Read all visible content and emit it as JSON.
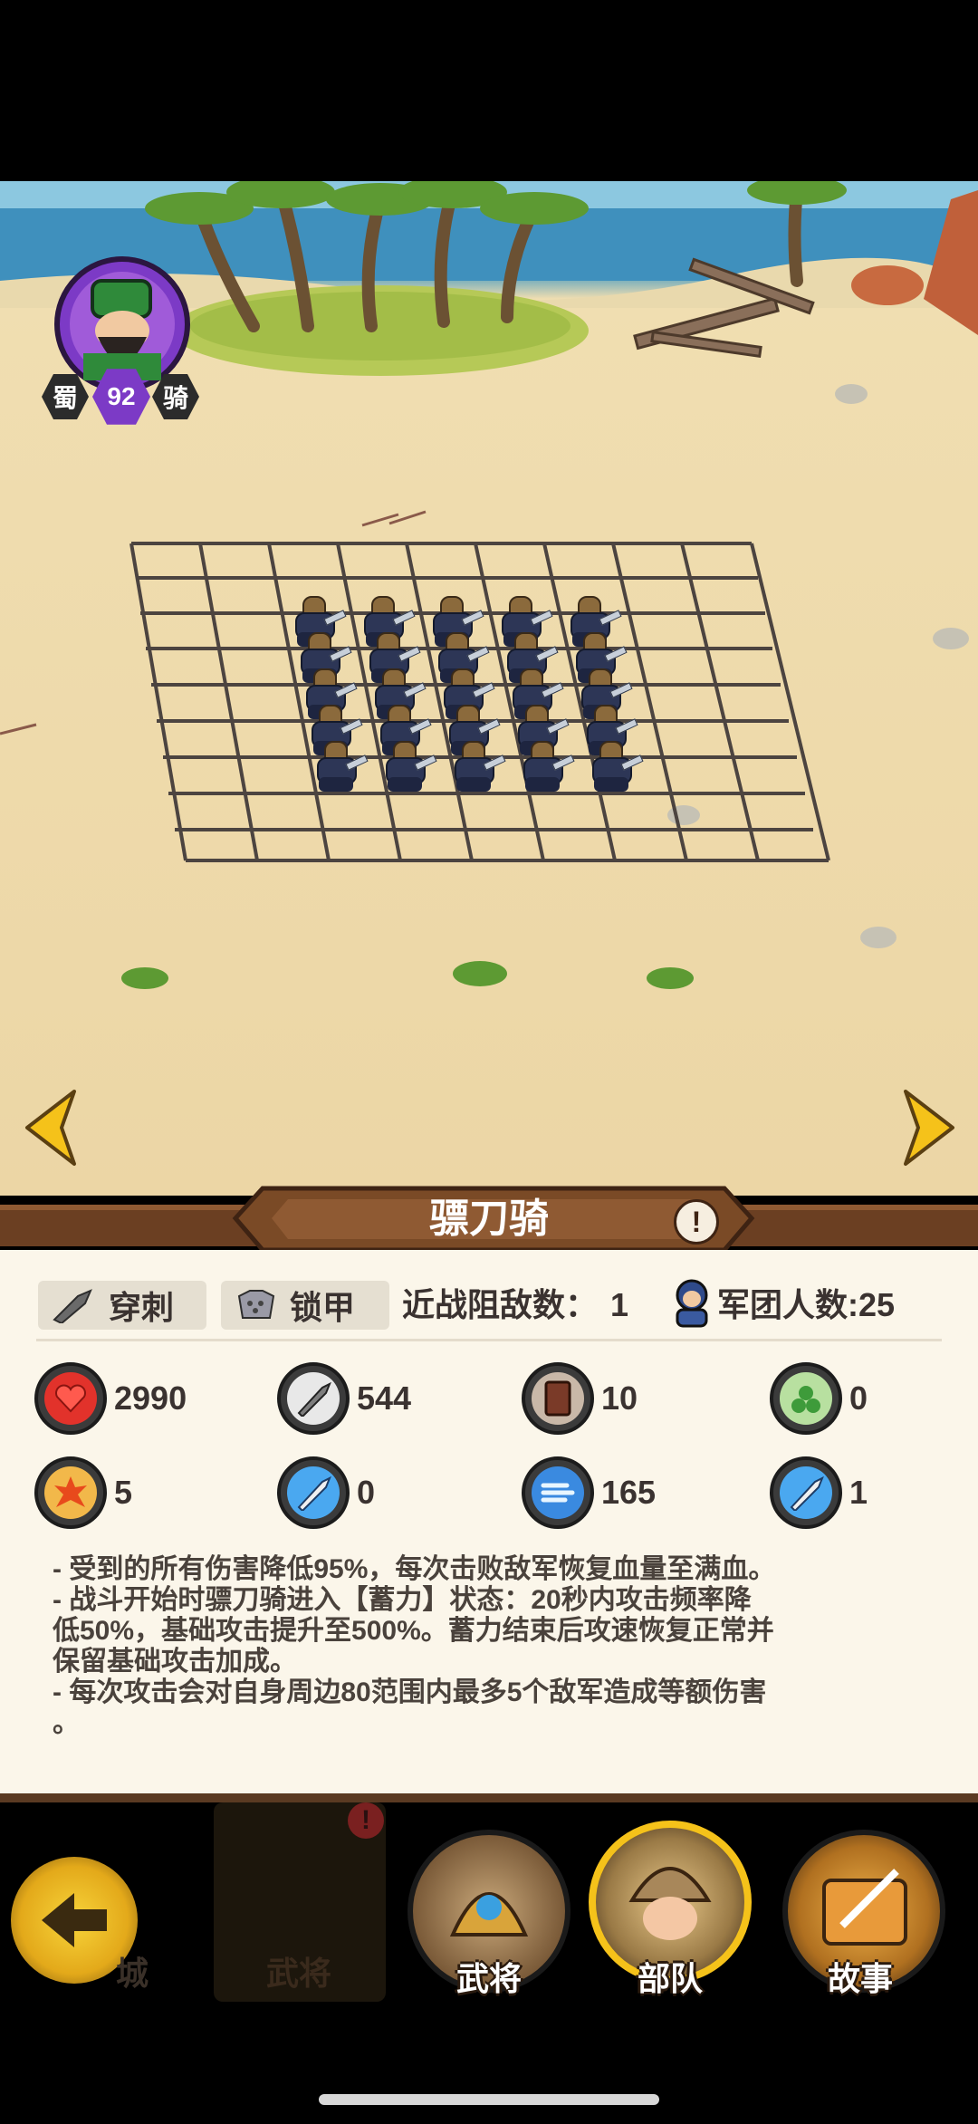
{
  "hero": {
    "faction": "蜀",
    "level": "92",
    "type": "骑"
  },
  "unit": {
    "name": "骠刀骑",
    "attack_tag": "穿刺",
    "armor_tag": "锁甲",
    "block_label": "近战阻敌数：",
    "block_value": "1",
    "legion_label": "军团人数:25"
  },
  "stats": {
    "hp": "2990",
    "attack": "544",
    "armor": "10",
    "magic_resist": "0",
    "crit": "5",
    "speed": "0",
    "move": "165",
    "range": "1"
  },
  "description": [
    " - 受到的所有伤害降低95%，每次击败敌军恢复血量至满血。",
    " - 战斗开始时骠刀骑进入【蓄力】状态：20秒内攻击频率降",
    "低50%，基础攻击提升至500%。蓄力结束后攻速恢复正常并",
    "保留基础攻击加成。",
    " - 每次攻击会对自身周边80范围内最多5个敌军造成等额伤害",
    "。"
  ],
  "nav": {
    "left1": "城",
    "left2": "武将",
    "item1": "武将",
    "item2": "部队",
    "item3": "故事"
  },
  "colors": {
    "gold": "#f5c21a",
    "hero_purple": "#7c3ac6",
    "banner_brown": "#6b3f22"
  }
}
